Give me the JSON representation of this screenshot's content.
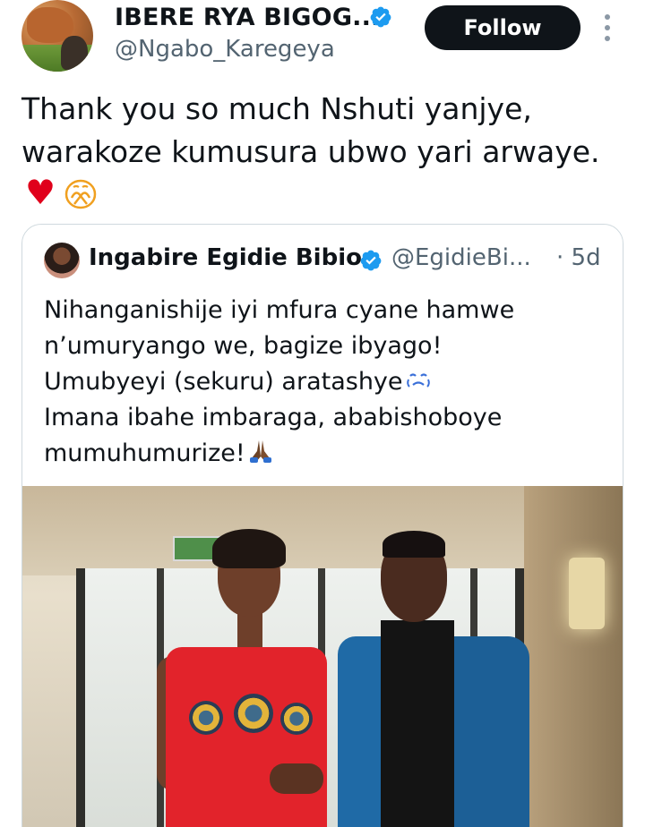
{
  "tweet": {
    "author": {
      "display_name": "IBERE RYA BIGOG...",
      "handle": "@Ngabo_Karegeya",
      "verified_icon": "verified-badge-icon"
    },
    "follow_label": "Follow",
    "more_icon": "more-options-icon",
    "text_line1": "Thank you so much Nshuti yanjye,",
    "text_line2": "warakoze kumusura ubwo yari arwaye.",
    "emoji1": "♥",
    "emoji2_icon": "praying-face-emoji"
  },
  "quote": {
    "author": {
      "display_name": "Ingabire Egidie Bibio",
      "handle": "@EgidieBi...",
      "verified_icon": "verified-badge-icon"
    },
    "time": "· 5d",
    "lines": [
      "Nihanganishije iyi mfura cyane hamwe",
      "n’umuryango we, bagize ibyago!",
      "Umubyeyi (sekuru) aratashye",
      "Imana ibahe imbaraga, ababishoboye",
      "mumuhumurize!"
    ],
    "photo_description_icon": "photo-couple-image"
  },
  "colors": {
    "text": "#0f1419",
    "secondary": "#536471",
    "verified": "#1d9bf0",
    "button_bg": "#0f1419",
    "button_text": "#ffffff",
    "border": "#cfd9de",
    "heart": "#e0001b"
  }
}
